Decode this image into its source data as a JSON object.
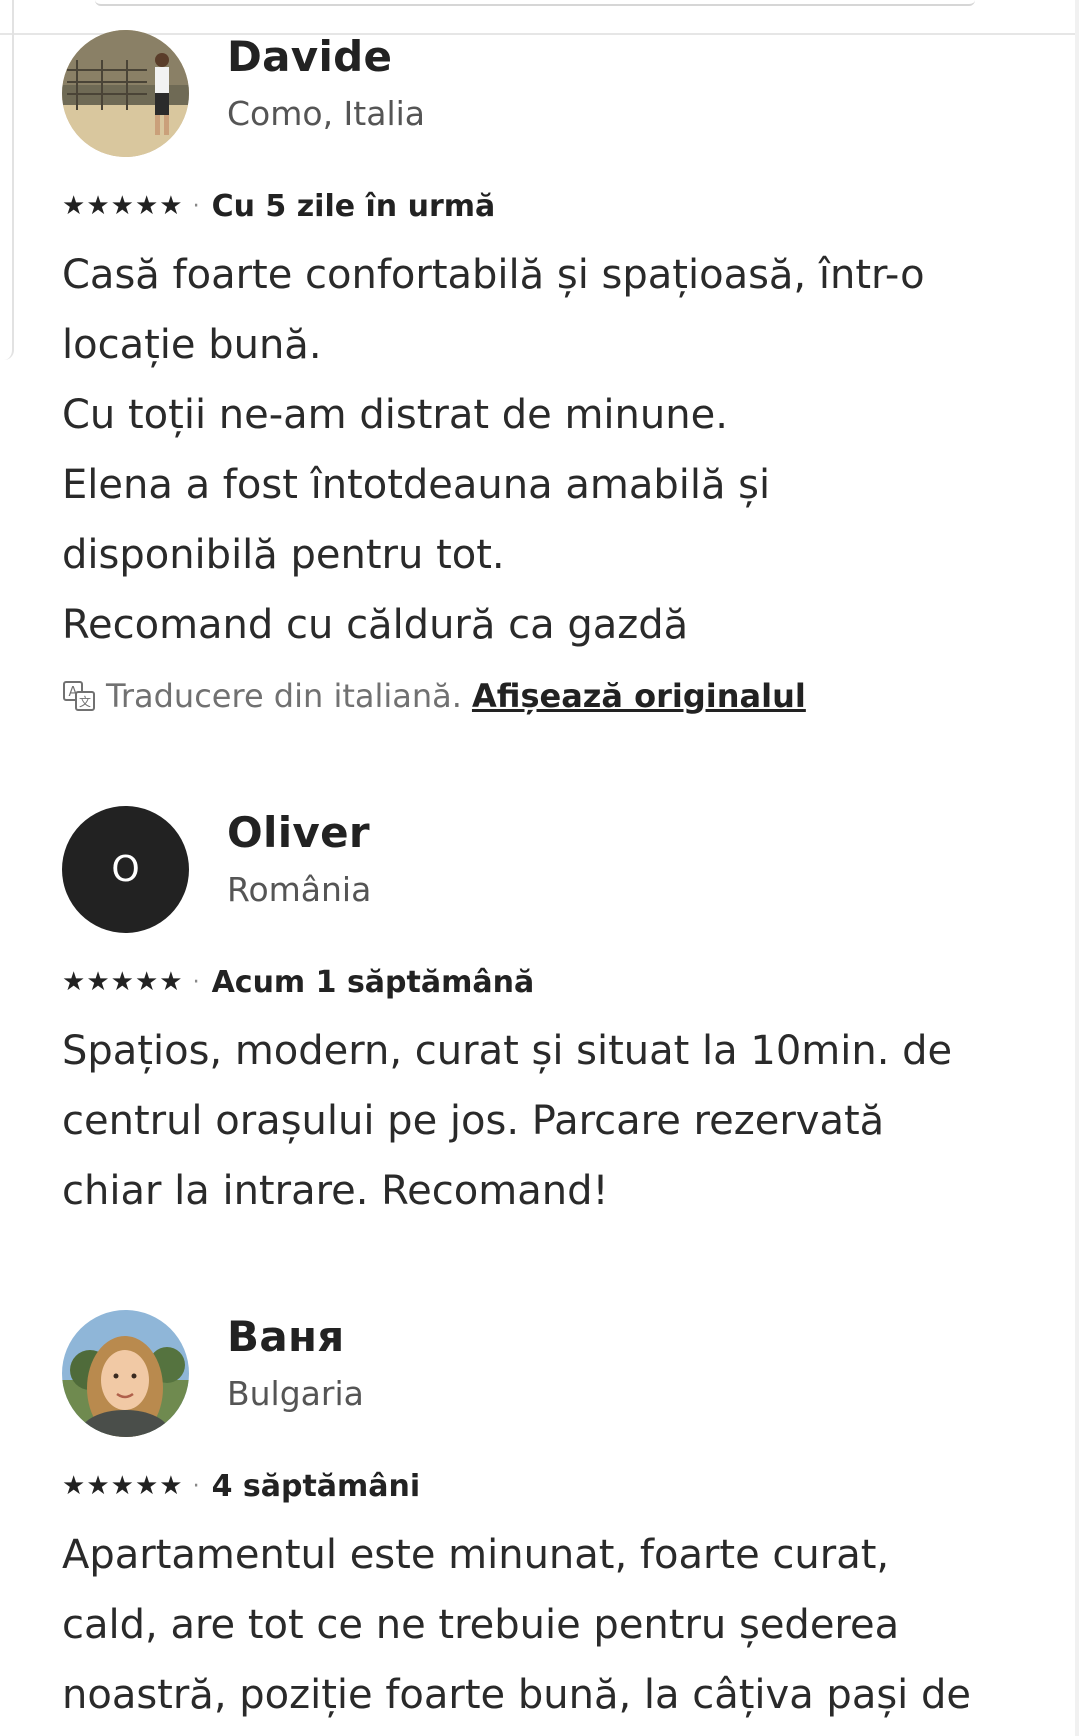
{
  "reviews": [
    {
      "name": "Davide",
      "location": "Como, Italia",
      "rating": 5,
      "date": "Cu 5 zile în urmă",
      "body": "Casă foarte confortabilă și spațioasă, într-o\nlocație bună.\nCu toții ne-am distrat de minune.\nElena a fost întotdeauna amabilă și\ndisponibilă pentru tot.\nRecomand cu căldură ca gazdă",
      "translation_note": "Traducere din italiană.",
      "show_original_label": "Afișează originalul"
    },
    {
      "name": "Oliver",
      "avatar_initial": "O",
      "location": "România",
      "rating": 5,
      "date": "Acum 1 săptămână",
      "body": "Spațios, modern, curat și situat la 10min. de\ncentrul orașului pe jos. Parcare rezervată\nchiar la intrare. Recomand!"
    },
    {
      "name": "Ваня",
      "location": "Bulgaria",
      "rating": 5,
      "date": "4 săptămâni",
      "body": "Apartamentul este minunat, foarte curat,\ncald, are tot ce ne trebuie pentru șederea\nnoastră, poziție foarte bună, la câțiva pași de"
    }
  ],
  "icons": {
    "star": "star-icon",
    "translate": "translate-icon"
  },
  "colors": {
    "text": "#222222",
    "secondary": "#717171",
    "avatar_bg": "#222222"
  }
}
